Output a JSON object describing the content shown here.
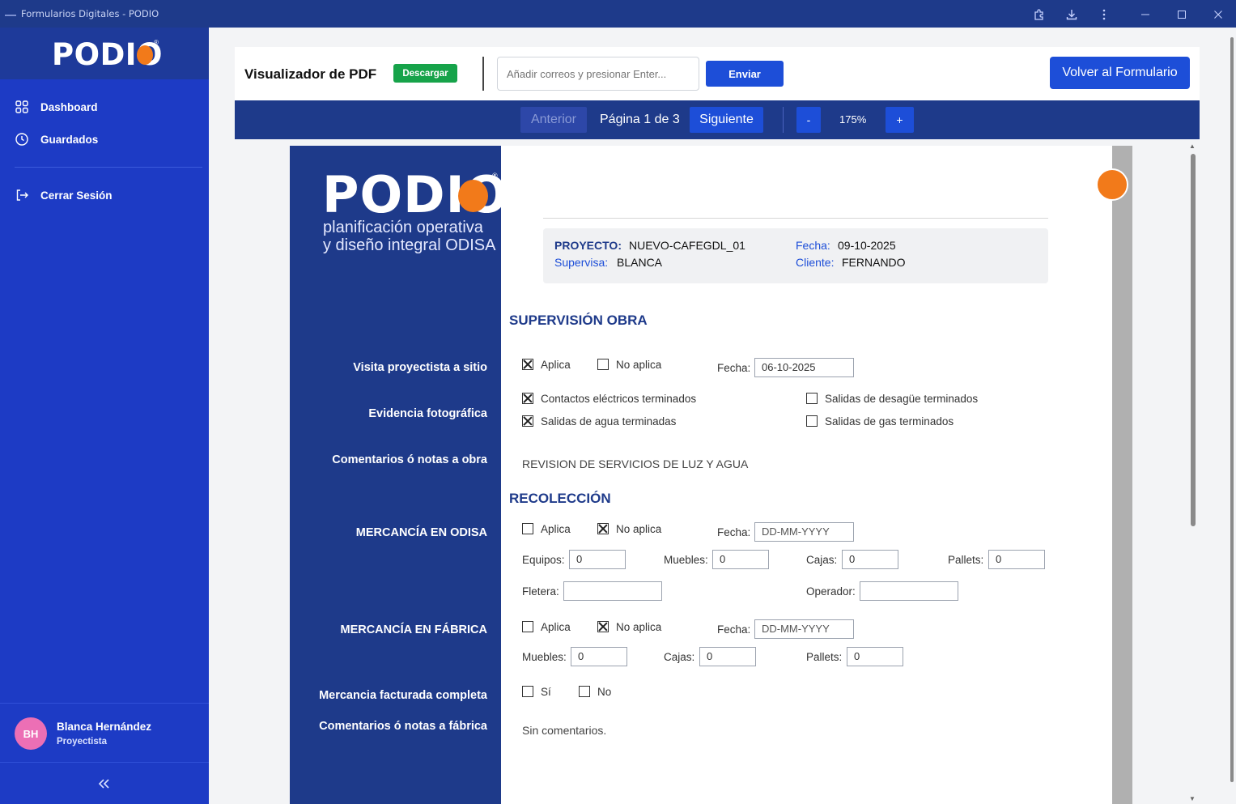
{
  "window": {
    "title": "Formularios Digitales - PODIO"
  },
  "sidebar": {
    "logo": "PODIO",
    "items": [
      {
        "label": "Dashboard",
        "icon": "grid-icon"
      },
      {
        "label": "Guardados",
        "icon": "clock-icon"
      }
    ],
    "logout_label": "Cerrar Sesión",
    "user": {
      "initials": "BH",
      "name": "Blanca Hernández",
      "role": "Proyectista"
    }
  },
  "viewer": {
    "title": "Visualizador de PDF",
    "download_label": "Descargar",
    "email_placeholder": "Añadir correos y presionar Enter...",
    "send_label": "Enviar",
    "back_label": "Volver al Formulario"
  },
  "pager": {
    "prev_label": "Anterior",
    "page_label": "Página 1 de 3",
    "next_label": "Siguiente",
    "minus_label": "-",
    "zoom": "175%",
    "plus_label": "+"
  },
  "pdf": {
    "logo": "PODIO",
    "tagline_1": "planificación operativa",
    "tagline_2": "y diseño integral ODISA",
    "info": {
      "proyecto_key": "PROYECTO:",
      "proyecto_val": "NUEVO-CAFEGDL_01",
      "fecha_key": "Fecha:",
      "fecha_val": "09-10-2025",
      "supervisa_key": "Supervisa:",
      "supervisa_val": "BLANCA",
      "cliente_key": "Cliente:",
      "cliente_val": "FERNANDO"
    },
    "sections": {
      "supervision": "SUPERVISIÓN OBRA",
      "recoleccion": "RECOLECCIÓN"
    },
    "rows": {
      "visita": "Visita proyectista a sitio",
      "evidencia": "Evidencia fotográfica",
      "comentarios_obra": "Comentarios ó notas a obra",
      "mercancia_odisa": "MERCANCÍA EN ODISA",
      "mercancia_fabrica": "MERCANCÍA EN FÁBRICA",
      "facturada": "Mercancia facturada completa",
      "comentarios_fabrica": "Comentarios ó notas a fábrica"
    },
    "visita": {
      "aplica": "Aplica",
      "aplica_checked": true,
      "no_aplica": "No aplica",
      "no_aplica_checked": false,
      "fecha_label": "Fecha:",
      "fecha_val": "06-10-2025"
    },
    "evidencia": {
      "opt1": "Contactos eléctricos terminados",
      "opt2": "Salidas de agua terminadas",
      "opt3": "Salidas de desagüe terminados",
      "opt4": "Salidas de gas terminados"
    },
    "comentarios_obra_text": "REVISION DE SERVICIOS DE LUZ Y AGUA",
    "odisa": {
      "aplica": "Aplica",
      "no_aplica": "No aplica",
      "fecha_label": "Fecha:",
      "fecha_val": "DD-MM-YYYY",
      "equipos_label": "Equipos:",
      "equipos_val": "0",
      "muebles_label": "Muebles:",
      "muebles_val": "0",
      "cajas_label": "Cajas:",
      "cajas_val": "0",
      "pallets_label": "Pallets:",
      "pallets_val": "0",
      "fletera_label": "Fletera:",
      "fletera_val": "",
      "operador_label": "Operador:",
      "operador_val": ""
    },
    "fabrica": {
      "aplica": "Aplica",
      "no_aplica": "No aplica",
      "fecha_label": "Fecha:",
      "fecha_val": "DD-MM-YYYY",
      "muebles_label": "Muebles:",
      "muebles_val": "0",
      "cajas_label": "Cajas:",
      "cajas_val": "0",
      "pallets_label": "Pallets:",
      "pallets_val": "0"
    },
    "facturada": {
      "si": "Sí",
      "no": "No"
    },
    "comentarios_fabrica_text": "Sin comentarios."
  }
}
